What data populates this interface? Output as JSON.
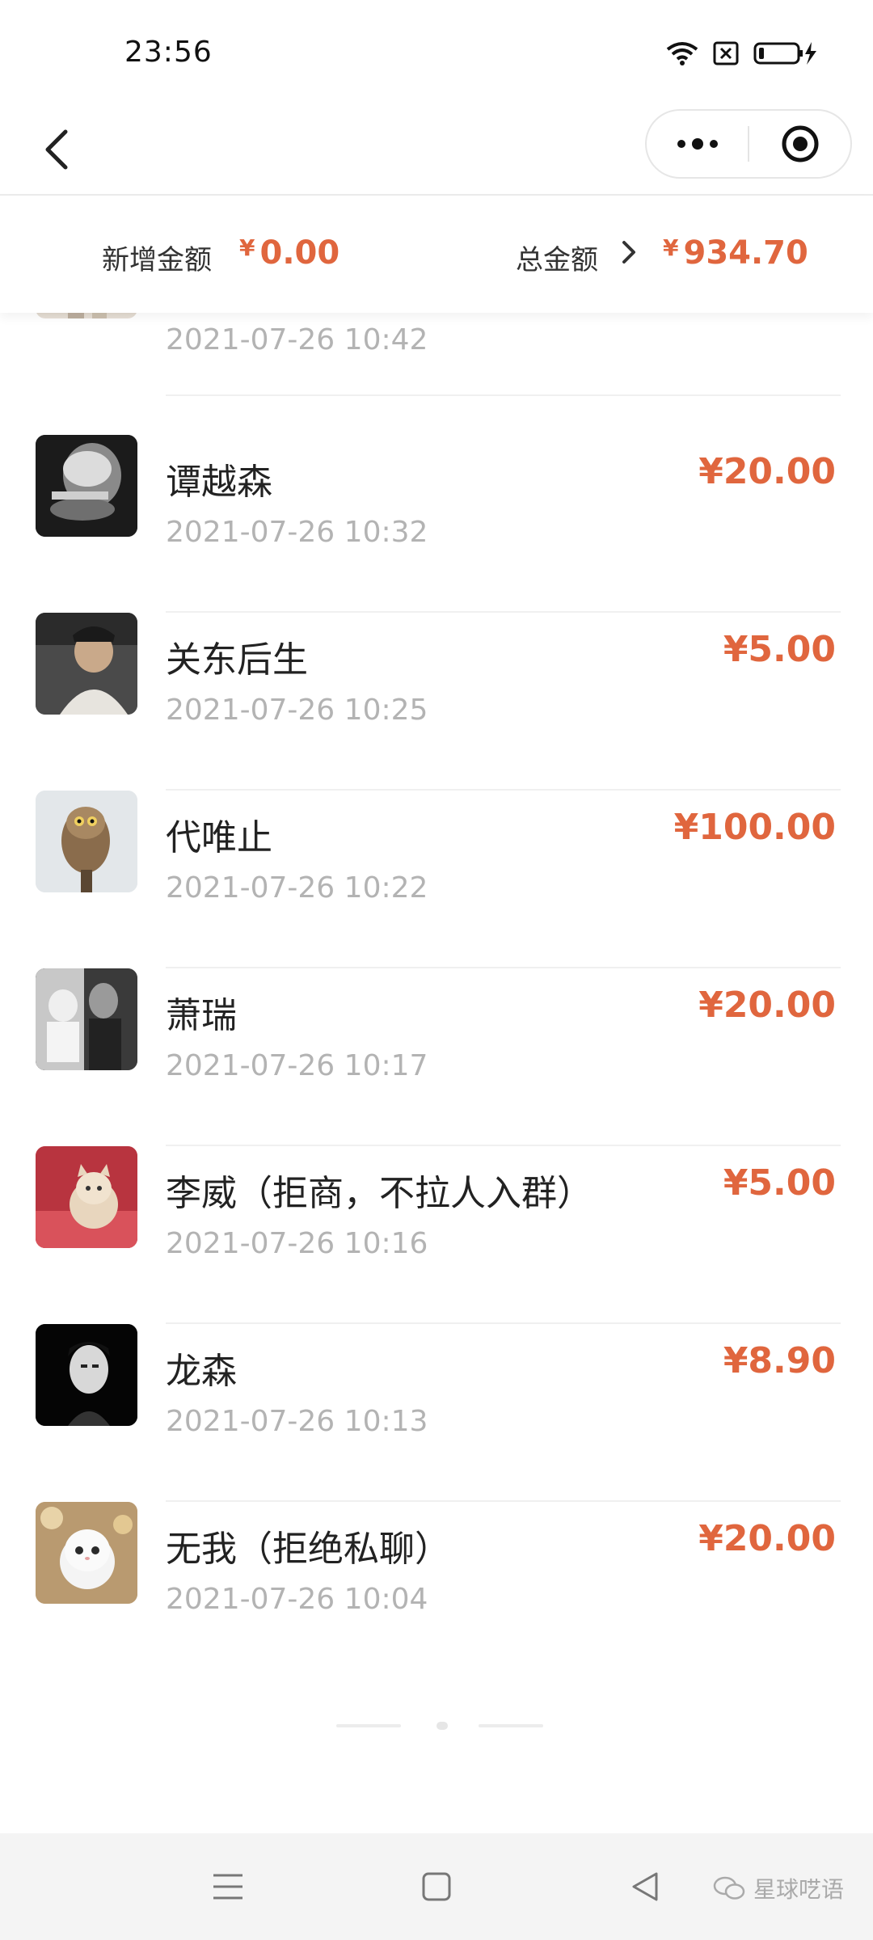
{
  "status_bar": {
    "time": "23:56",
    "icons": [
      "wifi-icon",
      "sim-blocked-icon",
      "battery-charging-icon"
    ]
  },
  "nav": {
    "back_icon": "back-arrow-icon",
    "more_icon": "more-dots-icon",
    "close_icon": "target-close-icon"
  },
  "summary": {
    "new_label": "新增金额",
    "new_currency": "¥",
    "new_value": "0.00",
    "total_label": "总金额",
    "total_currency": "¥",
    "total_value": "934.70"
  },
  "partial_row": {
    "time": "2021-07-26 10:42"
  },
  "rows": [
    {
      "name": "谭越森",
      "time": "2021-07-26 10:32",
      "amount": "¥20.00"
    },
    {
      "name": "关东后生",
      "time": "2021-07-26 10:25",
      "amount": "¥5.00"
    },
    {
      "name": "代唯止",
      "time": "2021-07-26 10:22",
      "amount": "¥100.00"
    },
    {
      "name": "萧瑞",
      "time": "2021-07-26 10:17",
      "amount": "¥20.00"
    },
    {
      "name": "李威（拒商，不拉人入群）",
      "time": "2021-07-26 10:16",
      "amount": "¥5.00"
    },
    {
      "name": "龙森",
      "time": "2021-07-26 10:13",
      "amount": "¥8.90"
    },
    {
      "name": "无我（拒绝私聊）",
      "time": "2021-07-26 10:04",
      "amount": "¥20.00"
    }
  ],
  "system_nav": {
    "menu_icon": "menu-icon",
    "home_icon": "home-square-icon",
    "back_icon": "back-triangle-icon"
  },
  "watermark": {
    "text": "星球呓语"
  },
  "colors": {
    "accent": "#e0663e",
    "muted": "#b3b3b3"
  }
}
